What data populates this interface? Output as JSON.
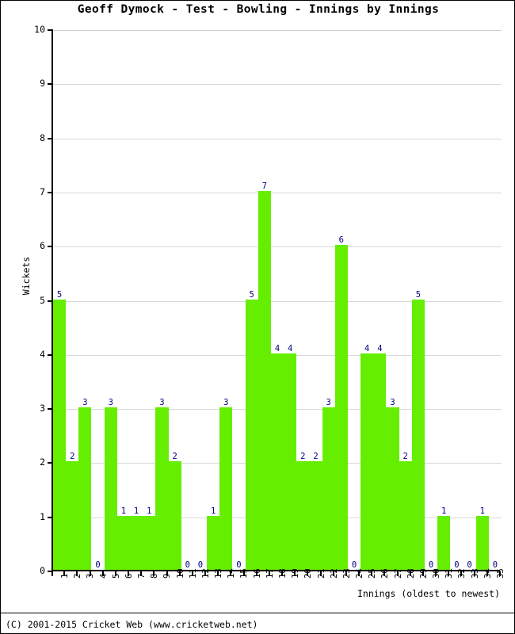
{
  "title": "Geoff Dymock - Test - Bowling - Innings by Innings",
  "footer": "(C) 2001-2015 Cricket Web (www.cricketweb.net)",
  "colors": {
    "bar": "#66ee00",
    "value_label": "#000080",
    "axis": "#000000",
    "grid": "#d8d8d8",
    "background": "#ffffff"
  },
  "chart_data": {
    "type": "bar",
    "title": "Geoff Dymock - Test - Bowling - Innings by Innings",
    "xlabel": "Innings (oldest to newest)",
    "ylabel": "Wickets",
    "ylim": [
      0,
      10
    ],
    "ytick_labels": [
      "0",
      "1",
      "2",
      "3",
      "4",
      "5",
      "6",
      "7",
      "8",
      "9",
      "10"
    ],
    "yticks": [
      0,
      1,
      2,
      3,
      4,
      5,
      6,
      7,
      8,
      9,
      10
    ],
    "grid": true,
    "legend": false,
    "categories": [
      "1",
      "2",
      "3",
      "4",
      "5",
      "6",
      "7",
      "8",
      "9",
      "10",
      "11",
      "12",
      "13",
      "14",
      "15",
      "16",
      "17",
      "18",
      "19",
      "20",
      "21",
      "22",
      "23",
      "24",
      "25",
      "26",
      "27",
      "28",
      "29",
      "30",
      "31",
      "32",
      "33",
      "34",
      "35"
    ],
    "values": [
      5,
      2,
      3,
      0,
      3,
      1,
      1,
      1,
      3,
      2,
      0,
      0,
      1,
      3,
      0,
      5,
      7,
      4,
      4,
      2,
      2,
      3,
      6,
      0,
      4,
      4,
      3,
      2,
      5,
      0,
      1,
      0,
      0,
      1,
      0
    ],
    "value_labels": [
      "5",
      "2",
      "3",
      "0",
      "3",
      "1",
      "1",
      "1",
      "3",
      "2",
      "0",
      "0",
      "1",
      "3",
      "0",
      "5",
      "7",
      "4",
      "4",
      "2",
      "2",
      "3",
      "6",
      "0",
      "4",
      "4",
      "3",
      "2",
      "5",
      "0",
      "1",
      "0",
      "0",
      "1",
      "0"
    ]
  }
}
